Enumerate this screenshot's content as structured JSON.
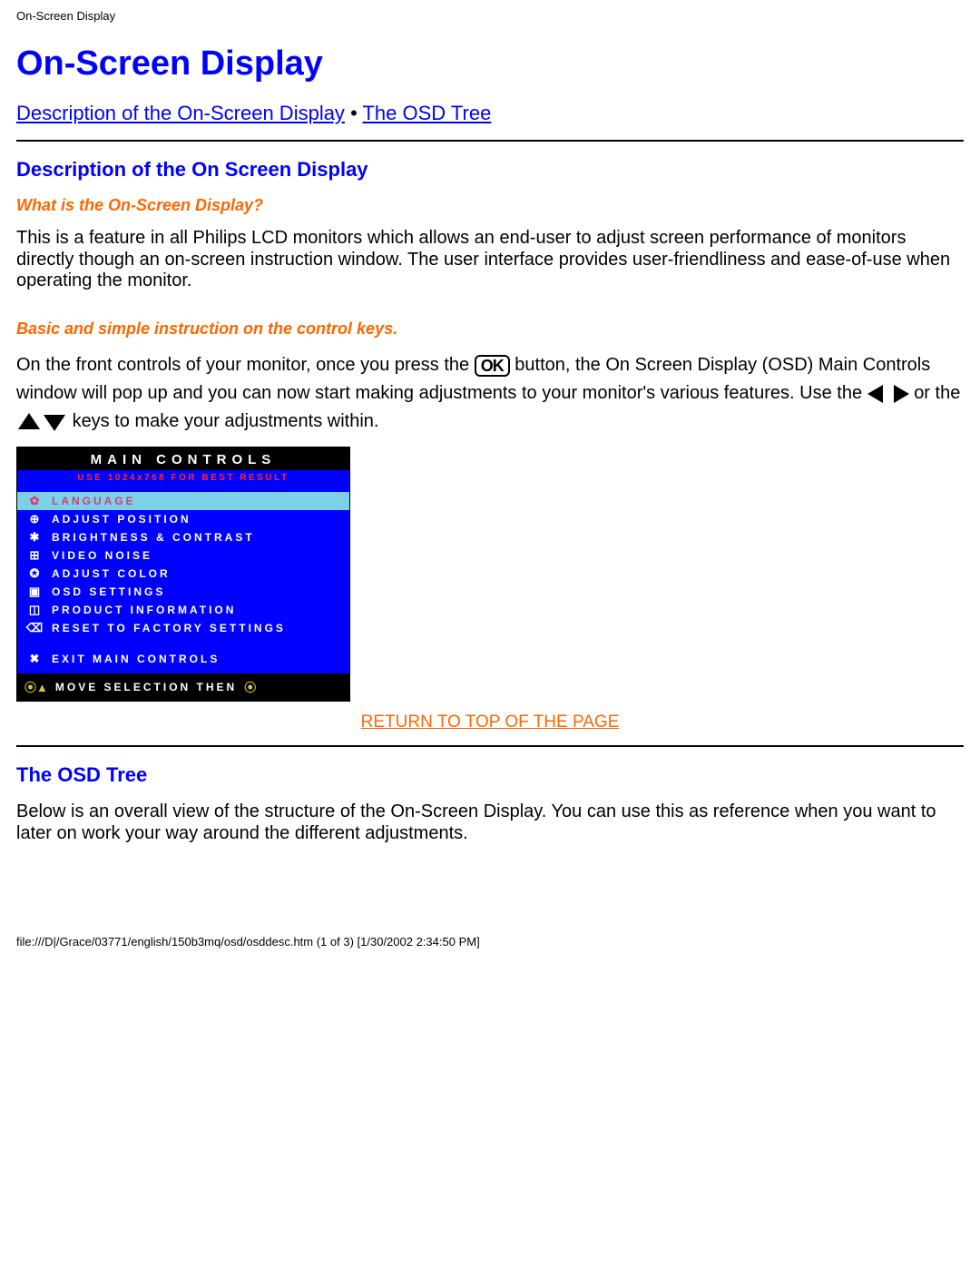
{
  "header": {
    "title": "On-Screen Display"
  },
  "page": {
    "h1": "On-Screen Display",
    "nav": {
      "link1": "Description of the On-Screen Display",
      "sep": "•",
      "link2": "The OSD Tree"
    },
    "section1": {
      "h2": "Description of the On Screen Display",
      "sub1": "What is the On-Screen Display?",
      "p1": "This is a feature in all Philips LCD monitors which allows an end-user to adjust screen performance of monitors directly though an on-screen instruction window. The user interface provides user-friendliness and ease-of-use when operating the monitor.",
      "sub2": "Basic and simple instruction on the control keys.",
      "p2a": "On the front controls of your monitor, once you press the ",
      "p2b": " button, the On Screen Display (OSD) Main Controls window will pop up and you can now start making adjustments to your monitor's various features. Use the ",
      "p2c": " or the ",
      "p2d": " keys to make your adjustments within."
    },
    "osd": {
      "header": "MAIN CONTROLS",
      "banner": "USE 1024x768 FOR BEST RESULT",
      "items": [
        {
          "icon": "✿",
          "label": "LANGUAGE",
          "hl": true
        },
        {
          "icon": "⊕",
          "label": "ADJUST POSITION",
          "hl": false
        },
        {
          "icon": "✱",
          "label": "BRIGHTNESS & CONTRAST",
          "hl": false
        },
        {
          "icon": "⊞",
          "label": "VIDEO NOISE",
          "hl": false
        },
        {
          "icon": "✪",
          "label": "ADJUST COLOR",
          "hl": false
        },
        {
          "icon": "▣",
          "label": "OSD SETTINGS",
          "hl": false
        },
        {
          "icon": "◫",
          "label": "PRODUCT INFORMATION",
          "hl": false
        },
        {
          "icon": "⌫",
          "label": "RESET TO FACTORY SETTINGS",
          "hl": false
        }
      ],
      "exit": {
        "icon": "✖",
        "label": "EXIT MAIN CONTROLS"
      },
      "footer": {
        "icons": "⦿▲",
        "label": "MOVE SELECTION THEN",
        "icon2": "⦿"
      }
    },
    "return_link": "RETURN TO TOP OF THE PAGE",
    "section2": {
      "h2": "The OSD Tree",
      "p1": "Below is an overall view of the structure of the On-Screen Display. You can use this as reference when you want to later on work your way around the different adjustments."
    }
  },
  "footer": {
    "path": "file:///D|/Grace/03771/english/150b3mq/osd/osddesc.htm (1 of 3) [1/30/2002 2:34:50 PM]"
  },
  "icons": {
    "ok": "OK"
  }
}
